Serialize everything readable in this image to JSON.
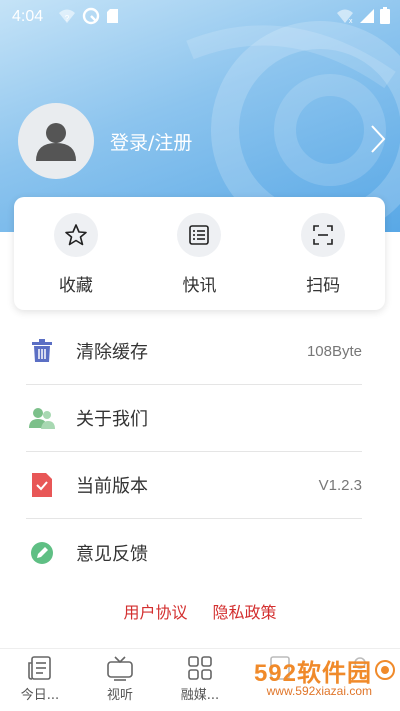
{
  "status_bar": {
    "time": "4:04"
  },
  "profile": {
    "login_label": "登录/注册"
  },
  "quick_actions": [
    {
      "label": "收藏",
      "icon": "star-icon"
    },
    {
      "label": "快讯",
      "icon": "list-icon"
    },
    {
      "label": "扫码",
      "icon": "scan-icon"
    }
  ],
  "menu": [
    {
      "label": "清除缓存",
      "value": "108Byte",
      "icon": "trash-icon",
      "color": "#5b6fc4"
    },
    {
      "label": "关于我们",
      "value": "",
      "icon": "users-icon",
      "color": "#7cc08a"
    },
    {
      "label": "当前版本",
      "value": "V1.2.3",
      "icon": "document-check-icon",
      "color": "#e85757"
    },
    {
      "label": "意见反馈",
      "value": "",
      "icon": "pencil-icon",
      "color": "#5fbf84"
    }
  ],
  "policy": {
    "user_agreement": "用户协议",
    "privacy_policy": "隐私政策"
  },
  "tabs": [
    {
      "label": "今日...",
      "icon": "newspaper-icon"
    },
    {
      "label": "视听",
      "icon": "tv-icon"
    },
    {
      "label": "融媒...",
      "icon": "grid-icon"
    },
    {
      "label": "",
      "icon": "document-icon"
    },
    {
      "label": "",
      "icon": "user-icon"
    }
  ],
  "watermark": {
    "brand": "592软件园",
    "url": "www.592xiazai.com"
  },
  "colors": {
    "accent": "#59a8e6",
    "policy_link": "#d32f2f",
    "watermark": "#f08a2a"
  }
}
